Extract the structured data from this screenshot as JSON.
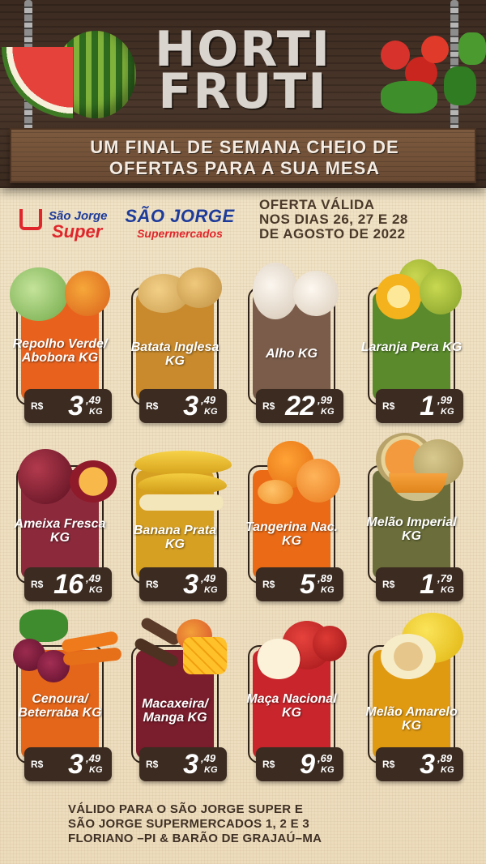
{
  "header": {
    "title_line1": "HORTI",
    "title_line2": "FRUTI",
    "subtitle_line1": "UM FINAL DE SEMANA CHEIO DE",
    "subtitle_line2": "OFERTAS PARA A SUA MESA"
  },
  "logos": {
    "logo1_line1": "São Jorge",
    "logo1_line2": "Super",
    "logo2_line1": "SÃO JORGE",
    "logo2_line2": "Supermercados"
  },
  "validity": {
    "line1": "OFERTA VÁLIDA",
    "line2": "NOS DIAS 26, 27 E 28",
    "line3": "DE AGOSTO DE 2022"
  },
  "products": [
    {
      "name": "Repolho Verde/ Abobora KG",
      "color": "#e8621e",
      "currency": "R$",
      "int": "3",
      "dec": ",49",
      "unit": "KG"
    },
    {
      "name": "Batata Inglesa KG",
      "color": "#c88a2c",
      "currency": "R$",
      "int": "3",
      "dec": ",49",
      "unit": "KG"
    },
    {
      "name": "Alho KG",
      "color": "#7b5c4a",
      "currency": "R$",
      "int": "22",
      "dec": ",99",
      "unit": "KG"
    },
    {
      "name": "Laranja Pera KG",
      "color": "#5a8a2c",
      "currency": "R$",
      "int": "1",
      "dec": ",99",
      "unit": "KG"
    },
    {
      "name": "Ameixa Fresca KG",
      "color": "#8c2a3c",
      "currency": "R$",
      "int": "16",
      "dec": ",49",
      "unit": "KG"
    },
    {
      "name": "Banana Prata KG",
      "color": "#d6a023",
      "currency": "R$",
      "int": "3",
      "dec": ",49",
      "unit": "KG"
    },
    {
      "name": "Tangerina Nac. KG",
      "color": "#ea6a16",
      "currency": "R$",
      "int": "5",
      "dec": ",89",
      "unit": "KG"
    },
    {
      "name": "Melão Imperial KG",
      "color": "#6b6e3a",
      "currency": "R$",
      "int": "1",
      "dec": ",79",
      "unit": "KG"
    },
    {
      "name": "Cenoura/ Beterraba KG",
      "color": "#e4661a",
      "currency": "R$",
      "int": "3",
      "dec": ",49",
      "unit": "KG"
    },
    {
      "name": "Macaxeira/ Manga KG",
      "color": "#7a1d2c",
      "currency": "R$",
      "int": "3",
      "dec": ",49",
      "unit": "KG"
    },
    {
      "name": "Maça Nacional KG",
      "color": "#c8262c",
      "currency": "R$",
      "int": "9",
      "dec": ",69",
      "unit": "KG"
    },
    {
      "name": "Melão Amarelo KG",
      "color": "#e09a12",
      "currency": "R$",
      "int": "3",
      "dec": ",89",
      "unit": "KG"
    }
  ],
  "footer": {
    "line1": "VÁLIDO PARA O SÃO JORGE SUPER E",
    "line2": "SÃO JORGE SUPERMERCADOS 1, 2 E 3",
    "line3": "FLORIANO –PI & BARÃO DE GRAJAÚ–MA"
  }
}
